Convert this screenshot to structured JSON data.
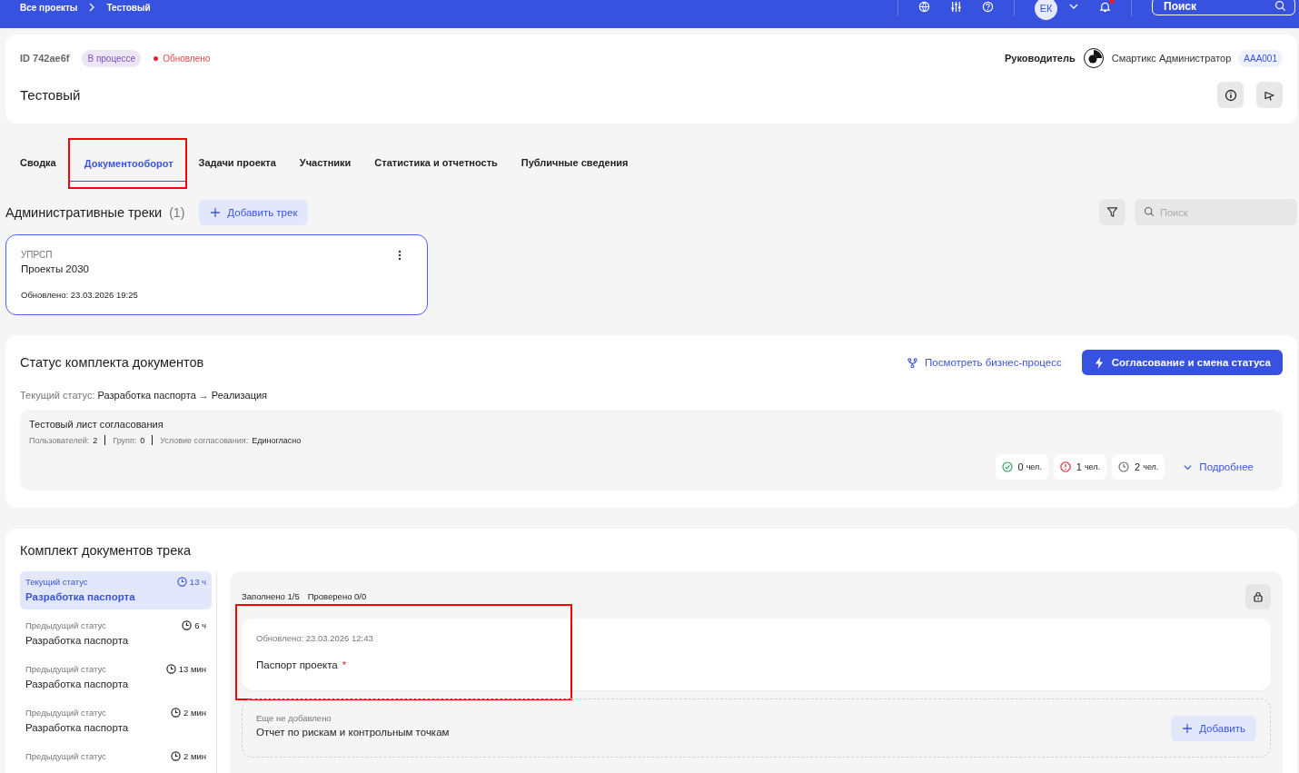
{
  "breadcrumbs": [
    {
      "label": "Все проекты"
    },
    {
      "label": "Тестовый"
    }
  ],
  "topbar": {
    "avatar": "ЕК",
    "notifications_unread": true,
    "search": {
      "placeholder": "Поиск"
    }
  },
  "project": {
    "id": "ID 742ae6f",
    "status_badge": "В процессе",
    "update_note": "Обновлено",
    "title": "Тестовый",
    "manager_label": "Руководитель",
    "manager_name": "Смартикс Администратор",
    "manager_code": "AAA001"
  },
  "tabs": [
    {
      "label": "Сводка",
      "selected": false,
      "highlighted": false
    },
    {
      "label": "Документооборот",
      "selected": true,
      "highlighted": true
    },
    {
      "label": "Задачи проекта",
      "selected": false,
      "highlighted": false
    },
    {
      "label": "Участники",
      "selected": false,
      "highlighted": false
    },
    {
      "label": "Статистика и отчетность",
      "selected": false,
      "highlighted": false
    },
    {
      "label": "Публичные сведения",
      "selected": false,
      "highlighted": false
    }
  ],
  "tracks": {
    "title": "Административные треки",
    "count": "(1)",
    "add_button": "Добавить трек",
    "search": {
      "placeholder": "Поиск"
    },
    "items": [
      {
        "code": "УПРСП",
        "name": "Проекты 2030",
        "updated": "Обновлено: 23.03.2026 19:25",
        "selected": true
      }
    ]
  },
  "doc_status": {
    "title": "Статус комплекта документов",
    "process_link": "Посмотреть бизнес-процесс",
    "approve_button": "Согласование и смена статуса",
    "current_label": "Текущий статус:",
    "current_value": "Разработка паспорта → Реализация",
    "approval_list": {
      "name": "Тестовый лист согласования",
      "meta": [
        {
          "label": "Пользователей:",
          "value": "2"
        },
        {
          "label": "Групп:",
          "value": "0"
        },
        {
          "label": "Условие согласования:",
          "value": "Единогласно"
        }
      ],
      "counters": [
        {
          "kind": "approved",
          "count": "0",
          "unit": "чел."
        },
        {
          "kind": "rejected",
          "count": "1",
          "unit": "чел."
        },
        {
          "kind": "pending",
          "count": "2",
          "unit": "чел."
        }
      ],
      "details_link": "Подробнее"
    }
  },
  "documents": {
    "title": "Комплект документов трека",
    "statuses": [
      {
        "label": "Текущий статус",
        "name": "Разработка паспорта",
        "duration": "13 ч",
        "selected": true
      },
      {
        "label": "Предыдущий статус",
        "name": "Разработка паспорта",
        "duration": "6 ч",
        "selected": false
      },
      {
        "label": "Предыдущий статус",
        "name": "Разработка паспорта",
        "duration": "13 мин",
        "selected": false
      },
      {
        "label": "Предыдущий статус",
        "name": "Разработка паспорта",
        "duration": "2 мин",
        "selected": false
      },
      {
        "label": "Предыдущий статус",
        "duration": "2 мин",
        "selected": false
      }
    ],
    "filled": "Заполнено 1/5",
    "checked": "Проверено 0/0",
    "items": [
      {
        "kind": "added",
        "note": "Обновлено: 23.03.2026 12:43",
        "name": "Паспорт проекта",
        "required_mark": "*",
        "highlighted": true
      },
      {
        "kind": "missing",
        "note": "Еще не добавлено",
        "name": "Отчет по рискам и контрольным точкам",
        "add_button": "Добавить",
        "highlighted": false
      }
    ]
  }
}
